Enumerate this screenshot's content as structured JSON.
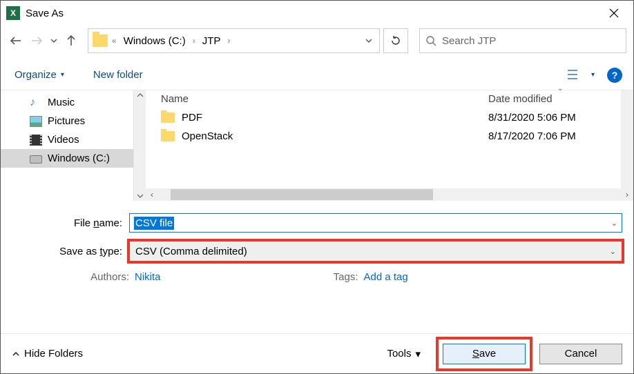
{
  "window": {
    "title": "Save As"
  },
  "nav": {
    "breadcrumb": {
      "prefix": "«",
      "parts": [
        "Windows (C:)",
        "JTP"
      ]
    },
    "search_placeholder": "Search JTP"
  },
  "toolbar": {
    "organize": "Organize",
    "new_folder": "New folder"
  },
  "sidebar": {
    "items": [
      {
        "label": "Music"
      },
      {
        "label": "Pictures"
      },
      {
        "label": "Videos"
      },
      {
        "label": "Windows (C:)"
      }
    ]
  },
  "list": {
    "columns": {
      "name": "Name",
      "date": "Date modified"
    },
    "rows": [
      {
        "name": "PDF",
        "date": "8/31/2020 5:06 PM"
      },
      {
        "name": "OpenStack",
        "date": "8/17/2020 7:06 PM"
      }
    ]
  },
  "form": {
    "name_label_pre": "File ",
    "name_label_u": "n",
    "name_label_post": "ame:",
    "name_value": "CSV file",
    "type_label_pre": "Save as ",
    "type_label_u": "t",
    "type_label_post": "ype:",
    "type_value": "CSV (Comma delimited)",
    "authors_label": "Authors:",
    "authors_value": "Nikita",
    "tags_label": "Tags:",
    "tags_value": "Add a tag"
  },
  "footer": {
    "hide_folders": "Hide Folders",
    "tools": "Tools",
    "save_pre": "",
    "save_u": "S",
    "save_post": "ave",
    "cancel": "Cancel"
  }
}
